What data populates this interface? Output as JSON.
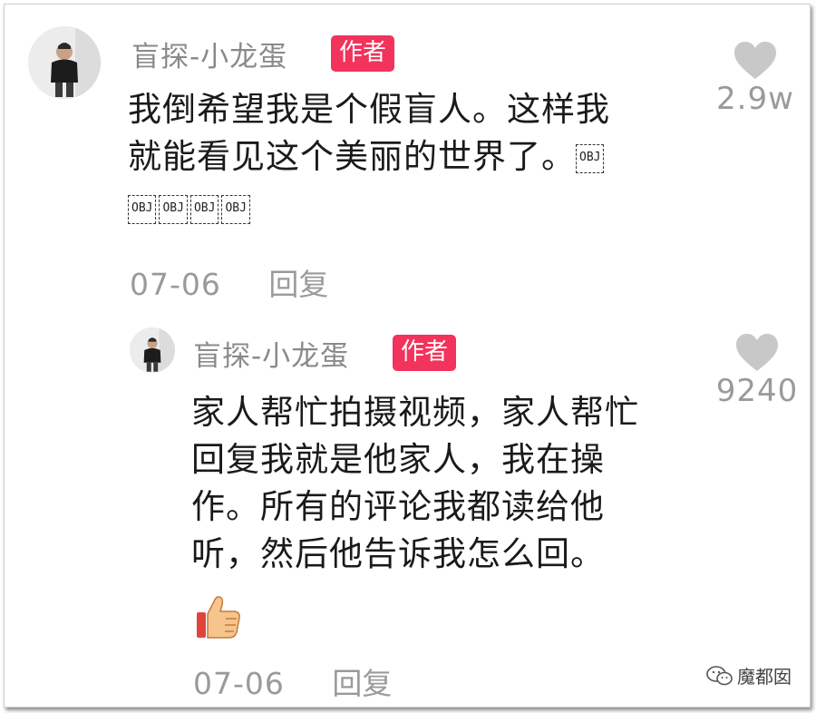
{
  "comment": {
    "username": "盲探-小龙蛋",
    "badge": "作者",
    "text_line1": "我倒希望我是个假盲人。这样我",
    "text_line2": "就能看见这个美丽的世界了。",
    "obj_label": "OBJ",
    "date": "07-06",
    "reply_label": "回复",
    "like_count": "2.9w",
    "avatar_icon": "person-avatar-icon",
    "like_icon": "heart-icon"
  },
  "reply": {
    "username": "盲探-小龙蛋",
    "badge": "作者",
    "text_line1": "家人帮忙拍摄视频，家人帮忙",
    "text_line2": "回复我就是他家人，我在操",
    "text_line3": "作。所有的评论我都读给他",
    "text_line4": "听，然后他告诉我怎么回。",
    "emoji_icon": "thumbs-up-icon",
    "date": "07-06",
    "reply_label": "回复",
    "like_count": "9240",
    "avatar_icon": "person-avatar-icon",
    "like_icon": "heart-icon"
  },
  "watermark": {
    "text": "魔都囡",
    "icon": "wechat-icon"
  },
  "colors": {
    "badge": "#f2335c",
    "muted_text": "#8a8a8a",
    "heart": "#c8c8c8",
    "body_text": "#1a1a1a"
  }
}
